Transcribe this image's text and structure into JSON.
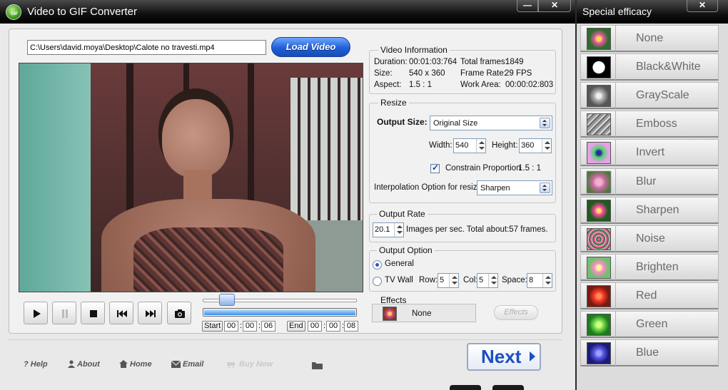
{
  "main_window": {
    "title": "Video to GIF Converter",
    "logo_text": "GIF",
    "minimize_glyph": "—",
    "close_glyph": "✕"
  },
  "file": {
    "path": "C:\\Users\\david.moya\\Desktop\\Calote no travesti.mp4",
    "load_label": "Load Video"
  },
  "video_info": {
    "title": "Video Information",
    "duration_label": "Duration:",
    "duration": "00:01:03:764",
    "total_frames_label": "Total frames:",
    "total_frames": "1849",
    "size_label": "Size:",
    "size": "540 x 360",
    "frame_rate_label": "Frame Rate:",
    "frame_rate": "29 FPS",
    "aspect_label": "Aspect:",
    "aspect": "1.5 : 1",
    "work_area_label": "Work Area:",
    "work_area": "00:00:02:803"
  },
  "resize": {
    "title": "Resize",
    "output_size_label": "Output Size:",
    "output_size": "Original Size",
    "width_label": "Width:",
    "width": "540",
    "height_label": "Height:",
    "height": "360",
    "constrain_label": "Constrain Proportion",
    "constrain_ratio": "1.5 : 1",
    "interp_label": "Interpolation Option for resize:",
    "interp": "Sharpen"
  },
  "output_rate": {
    "title": "Output Rate",
    "value": "20.1",
    "desc": "Images per sec. Total about:57 frames."
  },
  "output_option": {
    "title": "Output Option",
    "general_label": "General",
    "tvwall_label": "TV Wall",
    "row_label": "Row:",
    "row": "5",
    "col_label": "Col:",
    "col": "5",
    "space_label": "Space:",
    "space": "8"
  },
  "effects": {
    "title": "Effects",
    "current": "None",
    "button": "Effects"
  },
  "timeline": {
    "start_label": "Start",
    "start": [
      "00",
      "00",
      "06"
    ],
    "end_label": "End",
    "end": [
      "00",
      "00",
      "08"
    ],
    "sep": ":",
    "seek_position": 0.12
  },
  "links": {
    "help": "Help",
    "about": "About",
    "home": "Home",
    "email": "Email",
    "buy": "Buy Now"
  },
  "next_label": "Next",
  "effects_panel": {
    "title": "Special efficacy",
    "close_glyph": "✕",
    "items": [
      "None",
      "Black&White",
      "GrayScale",
      "Emboss",
      "Invert",
      "Blur",
      "Sharpen",
      "Noise",
      "Brighten",
      "Red",
      "Green",
      "Blue"
    ]
  },
  "colors": {
    "accent_blue": "#1b4fc2",
    "titlebar": "#111111",
    "panel_bg": "#f1f1f1"
  }
}
